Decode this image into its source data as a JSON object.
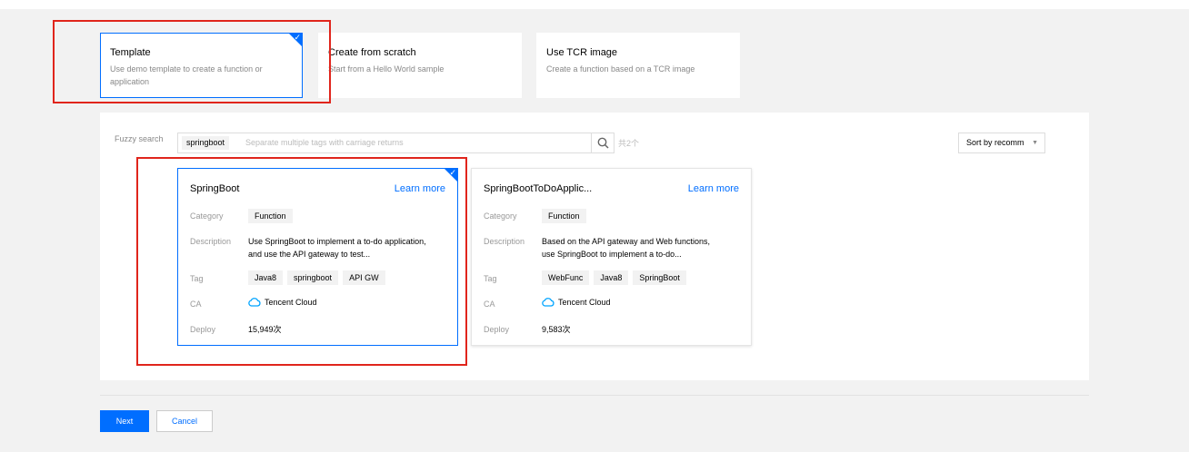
{
  "types": [
    {
      "title": "Template",
      "desc": "Use demo template to create a function or application"
    },
    {
      "title": "Create from scratch",
      "desc": "Start from a Hello World sample"
    },
    {
      "title": "Use TCR image",
      "desc": "Create a function based on a TCR image"
    }
  ],
  "search": {
    "label": "Fuzzy search",
    "tag": "springboot",
    "placeholder": "Separate multiple tags with carriage returns",
    "count": "共2个"
  },
  "sort": {
    "selected": "Sort by recomm"
  },
  "row_labels": {
    "category": "Category",
    "description": "Description",
    "tag": "Tag",
    "ca": "CA",
    "deploy": "Deploy"
  },
  "templates": [
    {
      "name": "SpringBoot",
      "learn_more": "Learn more",
      "category": "Function",
      "description": "Use SpringBoot to implement a to-do application, and use the API gateway to test...",
      "tags": [
        "Java8",
        "springboot",
        "API GW"
      ],
      "ca": "Tencent Cloud",
      "deploy": "15,949次"
    },
    {
      "name": "SpringBootToDoApplic...",
      "learn_more": "Learn more",
      "category": "Function",
      "description": "Based on the API gateway and Web functions, use SpringBoot to implement a to-do...",
      "tags": [
        "WebFunc",
        "Java8",
        "SpringBoot"
      ],
      "ca": "Tencent Cloud",
      "deploy": "9,583次"
    }
  ],
  "buttons": {
    "next": "Next",
    "cancel": "Cancel"
  },
  "colors": {
    "accent": "#006eff",
    "highlight": "#e0251c"
  }
}
